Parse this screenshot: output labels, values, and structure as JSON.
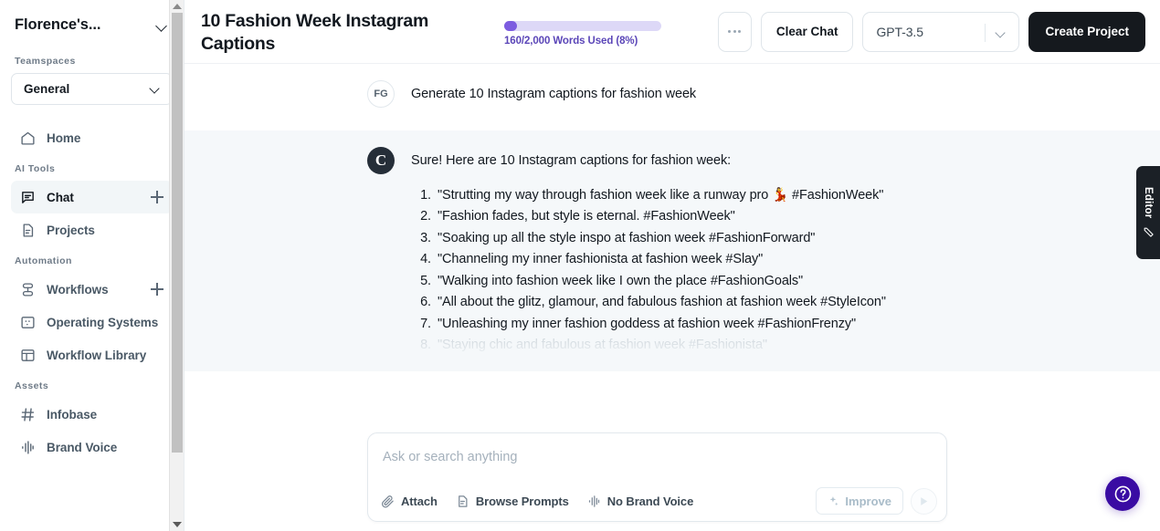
{
  "sidebar": {
    "workspace_name": "Florence's...",
    "teamspaces_label": "Teamspaces",
    "teamspace_selected": "General",
    "home_label": "Home",
    "ai_tools_label": "AI Tools",
    "chat_label": "Chat",
    "projects_label": "Projects",
    "automation_label": "Automation",
    "workflows_label": "Workflows",
    "operating_systems_label": "Operating Systems",
    "workflow_library_label": "Workflow Library",
    "assets_label": "Assets",
    "infobase_label": "Infobase",
    "brand_voice_label": "Brand Voice"
  },
  "header": {
    "title": "10 Fashion Week Instagram Captions",
    "words_used_text": "160/2,000 Words Used (8%)",
    "words_used_percent": 8,
    "words_used_current": 160,
    "words_used_max": 2000,
    "progress_color": "#7c5ce0",
    "progress_track_color": "#ddd8f7",
    "more_label": "•••",
    "clear_chat_label": "Clear Chat",
    "model_selected": "GPT-3.5",
    "create_project_label": "Create Project"
  },
  "chat": {
    "user_avatar_initials": "FG",
    "user_message": "Generate 10 Instagram captions for fashion week",
    "bot_avatar_initial": "C",
    "bot_intro": "Sure! Here are 10 Instagram captions for fashion week:",
    "captions": [
      {
        "num": "1.",
        "text": "\"Strutting my way through fashion week like a runway pro 💃 #FashionWeek\""
      },
      {
        "num": "2.",
        "text": "\"Fashion fades, but style is eternal. #FashionWeek\""
      },
      {
        "num": "3.",
        "text": "\"Soaking up all the style inspo at fashion week #FashionForward\""
      },
      {
        "num": "4.",
        "text": "\"Channeling my inner fashionista at fashion week #Slay\""
      },
      {
        "num": "5.",
        "text": "\"Walking into fashion week like I own the place #FashionGoals\""
      },
      {
        "num": "6.",
        "text": "\"All about the glitz, glamour, and fabulous fashion at fashion week #StyleIcon\""
      },
      {
        "num": "7.",
        "text": "\"Unleashing my inner fashion goddess at fashion week #FashionFrenzy\""
      },
      {
        "num": "8.",
        "text": "\"Staying chic and fabulous at fashion week #Fashionista\""
      }
    ]
  },
  "composer": {
    "placeholder": "Ask or search anything",
    "value": "",
    "attach_label": "Attach",
    "browse_prompts_label": "Browse Prompts",
    "brand_voice_label": "No Brand Voice",
    "improve_label": "Improve"
  },
  "editor_tab": {
    "label": "Editor"
  },
  "help": {
    "label": "?"
  }
}
